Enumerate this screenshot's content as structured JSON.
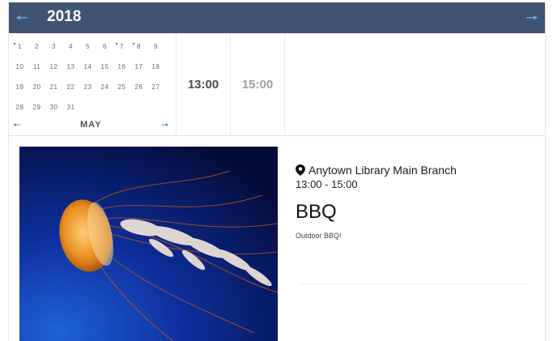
{
  "header": {
    "year": "2018",
    "prev_icon": "arrow-left",
    "next_icon": "arrow-right",
    "accent": "#3f5470"
  },
  "calendar": {
    "days": [
      {
        "d": "1",
        "dot": true
      },
      {
        "d": "2"
      },
      {
        "d": "3"
      },
      {
        "d": "4"
      },
      {
        "d": "5"
      },
      {
        "d": "6"
      },
      {
        "d": "7",
        "dot": true
      },
      {
        "d": "8",
        "dot": true
      },
      {
        "d": "9"
      },
      {
        "d": "10"
      },
      {
        "d": "11"
      },
      {
        "d": "12"
      },
      {
        "d": "13"
      },
      {
        "d": "14"
      },
      {
        "d": "15"
      },
      {
        "d": "16"
      },
      {
        "d": "17"
      },
      {
        "d": "18"
      },
      {
        "d": "19"
      },
      {
        "d": "20"
      },
      {
        "d": "21"
      },
      {
        "d": "22"
      },
      {
        "d": "23"
      },
      {
        "d": "24"
      },
      {
        "d": "25"
      },
      {
        "d": "26"
      },
      {
        "d": "27"
      },
      {
        "d": "28"
      },
      {
        "d": "29"
      },
      {
        "d": "30"
      },
      {
        "d": "31"
      }
    ],
    "month": "MAY",
    "month_prev_icon": "arrow-left",
    "month_next_icon": "arrow-right"
  },
  "times": {
    "slot1": "13:00",
    "slot2": "15:00"
  },
  "event": {
    "location": "Anytown Library Main Branch",
    "location_icon": "map-pin",
    "time_range": "13:00 - 15:00",
    "title": "BBQ",
    "description": "Outdoor BBQ!"
  }
}
